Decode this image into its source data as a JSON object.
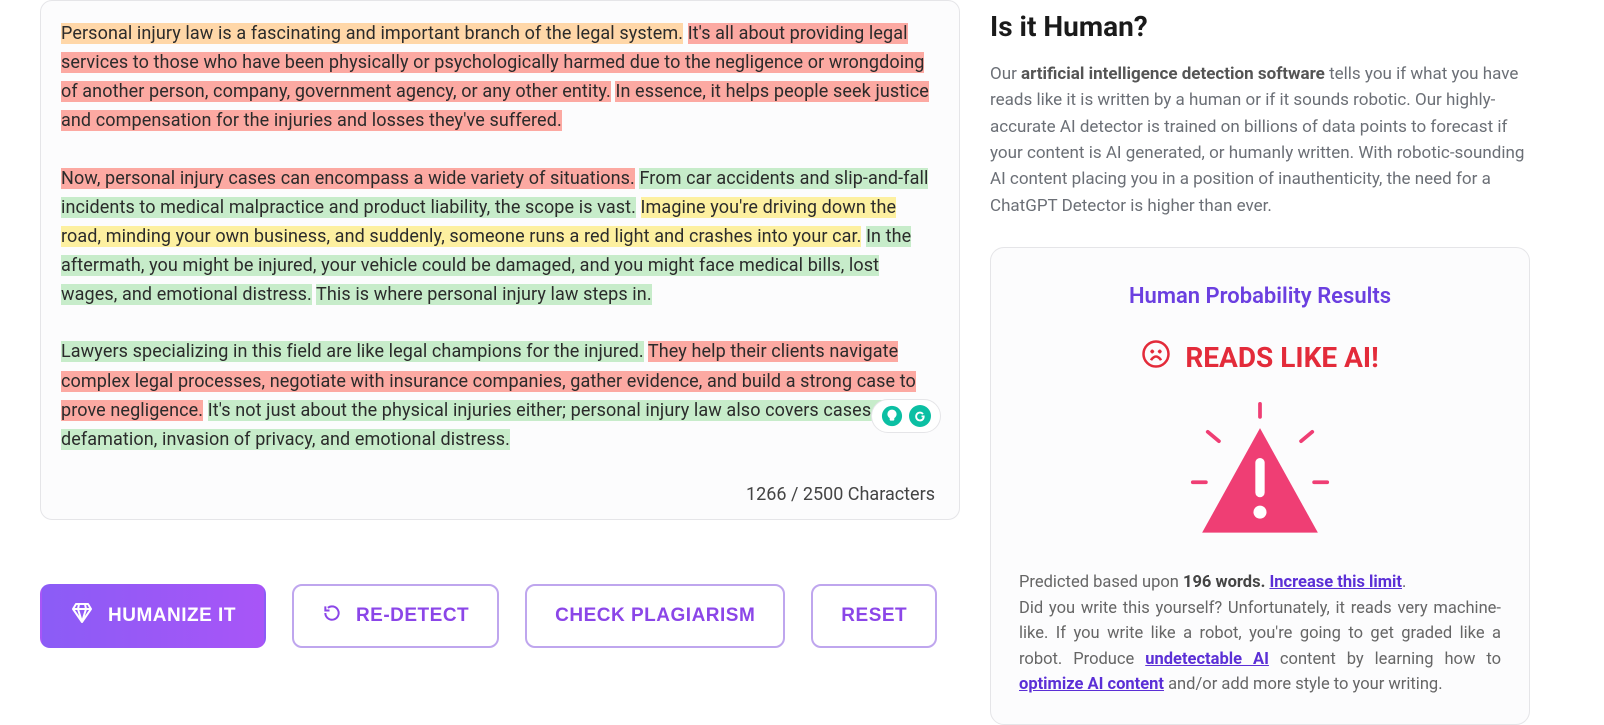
{
  "editor": {
    "segments": [
      {
        "t": "Personal injury law is a fascinating and important branch of the legal system.",
        "c": "hl-orange",
        "sp": true
      },
      {
        "t": "It's all about providing legal services to those who have been physically or psychologically harmed due to the negligence or wrongdoing of another person, company, government agency, or any other entity.",
        "c": "hl-red",
        "sp": true
      },
      {
        "t": "In essence, it helps people seek justice and compensation for the injuries and losses they've suffered.",
        "c": "hl-red",
        "br": true
      },
      {
        "t": "Now, personal injury cases can encompass a wide variety of situations.",
        "c": "hl-red",
        "sp": true
      },
      {
        "t": "From car accidents and slip-and-fall incidents to medical malpractice and product liability, the scope is vast.",
        "c": "hl-green",
        "sp": true
      },
      {
        "t": "Imagine you're driving down the road, minding your own business, and suddenly, someone runs a red light and crashes into your car.",
        "c": "hl-yellow",
        "sp": true
      },
      {
        "t": "In the aftermath, you might be injured, your vehicle could be damaged, and you might face medical bills, lost wages, and emotional distress.",
        "c": "hl-green",
        "sp": true
      },
      {
        "t": "This is where personal injury law steps in.",
        "c": "hl-green",
        "br": true
      },
      {
        "t": "Lawyers specializing in this field are like legal champions for the injured.",
        "c": "hl-green",
        "sp": true
      },
      {
        "t": "They help their clients navigate complex legal processes, negotiate with insurance companies, gather evidence, and build a strong case to prove negligence.",
        "c": "hl-red",
        "sp": true
      },
      {
        "t": "It's not just about the physical injuries either; personal injury law also covers cases of defamation, invasion of privacy, and emotional distress.",
        "c": "hl-green"
      }
    ],
    "counter": "1266 / 2500 Characters"
  },
  "buttons": {
    "humanize": "HUMANIZE IT",
    "redetect": "RE-DETECT",
    "plagiarism": "CHECK PLAGIARISM",
    "reset": "RESET"
  },
  "right": {
    "title": "Is it Human?",
    "desc_pre": "Our ",
    "desc_bold": "artificial intelligence detection software",
    "desc_post": " tells you if what you have reads like it is written by a human or if it sounds robotic. Our highly-accurate AI detector is trained on billions of data points to forecast if your content is AI generated, or humanly written. With robotic-sounding AI content placing you in a position of inauthenticity, the need for a ChatGPT Detector is higher than ever.",
    "result_title": "Human Probability Results",
    "verdict": "READS LIKE AI!",
    "pred_pre": "Predicted based upon ",
    "pred_bold": "196 words. ",
    "pred_linkA": "Increase this limit",
    "pred_dot": ".",
    "body1": "Did you write this yourself? Unfortunately, it reads very machine-like. If you write like a robot, you're going to get graded like a robot. Produce ",
    "linkB": "undetectable AI",
    "body2": " content by learning how to ",
    "linkC": "optimize AI content",
    "body3": " and/or add more style to your writing."
  }
}
